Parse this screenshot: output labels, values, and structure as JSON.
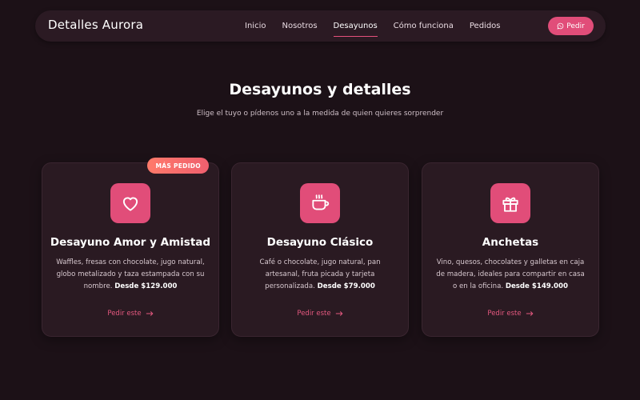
{
  "nav": {
    "brand": "Detalles Aurora",
    "links": [
      {
        "label": "Inicio"
      },
      {
        "label": "Nosotros"
      },
      {
        "label": "Desayunos",
        "active": true
      },
      {
        "label": "Cómo funciona"
      },
      {
        "label": "Pedidos"
      }
    ],
    "cta": {
      "label": "Pedir",
      "icon": "whatsapp-icon"
    }
  },
  "hero": {
    "title": "Desayunos y detalles",
    "subtitle": "Elige el tuyo o pídenos uno a la medida de quien quieres sorprender"
  },
  "cards": [
    {
      "badge": "MÁS PEDIDO",
      "icon": "heart-icon",
      "title": "Desayuno Amor y Amistad",
      "desc": "Waffles, fresas con chocolate, jugo natural, globo metalizado y taza estampada con su nombre.",
      "price": "Desde $129.000",
      "link": "Pedir este"
    },
    {
      "icon": "coffee-cup-icon",
      "title": "Desayuno Clásico",
      "desc": "Café o chocolate, jugo natural, pan artesanal, fruta picada y tarjeta personalizada.",
      "price": "Desde $79.000",
      "link": "Pedir este"
    },
    {
      "icon": "gift-icon",
      "title": "Anchetas",
      "desc": "Vino, quesos, chocolates y galletas en caja de madera, ideales para compartir en casa o en la oficina.",
      "price": "Desde $149.000",
      "link": "Pedir este"
    }
  ],
  "colors": {
    "background": "#1c1117",
    "surface": "#2a1a22",
    "accent": "#e14d79",
    "badge": "#ef6a6c"
  }
}
